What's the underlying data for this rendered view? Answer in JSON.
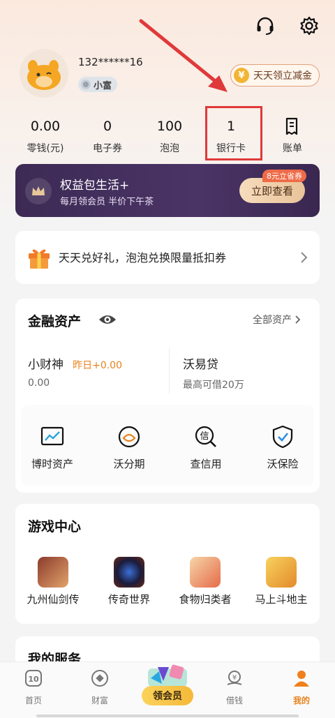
{
  "header": {
    "support_icon": "headset-icon",
    "settings_icon": "gear-icon"
  },
  "profile": {
    "phone": "132******16",
    "level": "小富",
    "coupon_label": "天天领立减金",
    "coin_glyph": "¥"
  },
  "stats": [
    {
      "value": "0.00",
      "label": "零钱(元)"
    },
    {
      "value": "0",
      "label": "电子券"
    },
    {
      "value": "100",
      "label": "泡泡"
    },
    {
      "value": "1",
      "label": "银行卡"
    },
    {
      "label": "账单",
      "icon": "bill-icon"
    }
  ],
  "annotation": {
    "highlight_color": "#e0393a"
  },
  "vip_banner": {
    "title": "权益包生活+",
    "subtitle": "每月领会员 半价下午茶",
    "button": "立即查看",
    "tag": "8元立省券"
  },
  "promo": {
    "text": "天天兑好礼，泡泡兑换限量抵扣券",
    "icon": "gift-icon"
  },
  "finance": {
    "title": "金融资产",
    "see_all": "全部资产",
    "left": {
      "name": "小财神",
      "delta": "昨日+0.00",
      "amount": "0.00"
    },
    "right": {
      "name": "沃易贷",
      "desc": "最高可借20万"
    },
    "grid": [
      {
        "label": "博时资产",
        "icon": "chart-icon"
      },
      {
        "label": "沃分期",
        "icon": "installment-icon"
      },
      {
        "label": "查信用",
        "icon": "credit-search-icon"
      },
      {
        "label": "沃保险",
        "icon": "shield-check-icon"
      }
    ]
  },
  "games": {
    "title": "游戏中心",
    "items": [
      {
        "label": "九州仙剑传"
      },
      {
        "label": "传奇世界"
      },
      {
        "label": "食物归类者"
      },
      {
        "label": "马上斗地主"
      }
    ]
  },
  "services": {
    "title": "我的服务"
  },
  "tabbar": {
    "items": [
      {
        "label": "首页",
        "icon": "home-icon"
      },
      {
        "label": "财富",
        "icon": "wealth-icon"
      },
      {
        "label": "领会员",
        "icon": "vip-icon"
      },
      {
        "label": "借钱",
        "icon": "borrow-icon"
      },
      {
        "label": "我的",
        "icon": "profile-icon"
      }
    ],
    "active": "我的"
  },
  "colors": {
    "accent": "#e8821c",
    "vip_bg": "#3d2a54",
    "highlight": "#e0393a"
  }
}
